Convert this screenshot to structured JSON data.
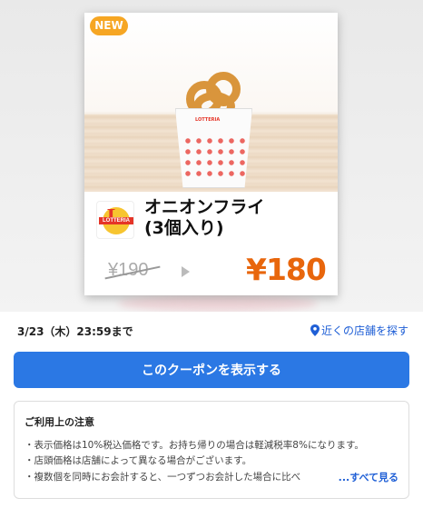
{
  "coupon": {
    "badge": "NEW",
    "product_name": "オニオンフライ\n(3個入り)",
    "old_price": "¥190",
    "new_price": "¥180",
    "logo_text": "LOTTERIA",
    "cup_text": "LOTTERIA"
  },
  "validity": {
    "deadline": "3/23（木）23:59まで",
    "store_link": "近くの店舗を探す"
  },
  "action": {
    "button_label": "このクーポンを表示する"
  },
  "notes": {
    "title": "ご利用上の注意",
    "lines": [
      "・表示価格は10%税込価格です。お持ち帰りの場合は軽減税率8%になります。",
      "・店頭価格は店舗によって異なる場合がございます。",
      "・複数個を同時にお会計すると、一つずつお会計した場合に比べ"
    ],
    "see_all": "...すべて見る"
  },
  "colors": {
    "accent_blue": "#2b78e4",
    "link_blue": "#1f5fd6",
    "price_orange": "#e8660c",
    "badge_orange": "#f6a623"
  }
}
